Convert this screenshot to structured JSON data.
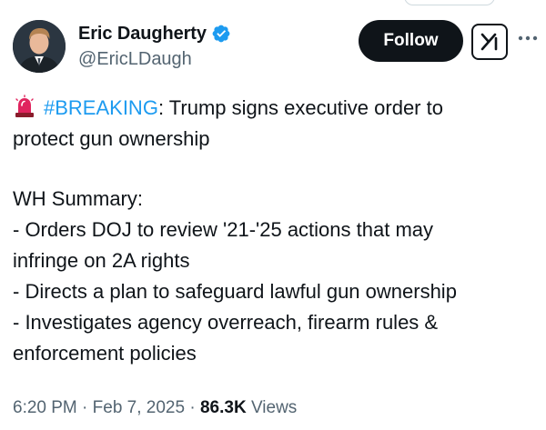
{
  "author": {
    "display_name": "Eric Daugherty",
    "handle": "@EricLDaugh",
    "verified": true
  },
  "actions": {
    "follow_label": "Follow",
    "grok_icon": "grok-icon",
    "more_icon": "more-horizontal-icon"
  },
  "tweet": {
    "hashtag": "#BREAKING",
    "headline_rest": ": Trump signs executive order to",
    "headline_line2": "protect gun ownership",
    "summary_title": "WH Summary:",
    "line1": "- Orders DOJ to review '21-'25 actions that may",
    "line2": "infringe on 2A rights",
    "line3": "- Directs a plan to safeguard lawful gun ownership",
    "line4": "- Investigates agency overreach, firearm rules &",
    "line5": "enforcement policies"
  },
  "meta": {
    "time": "6:20 PM",
    "sep1": " · ",
    "date": "Feb 7, 2025",
    "sep2": " · ",
    "views_count": "86.3K",
    "views_label": " Views"
  },
  "colors": {
    "accent": "#1d9bf0",
    "text": "#0f1419",
    "secondary": "#536471",
    "siren": "#e0245e"
  }
}
